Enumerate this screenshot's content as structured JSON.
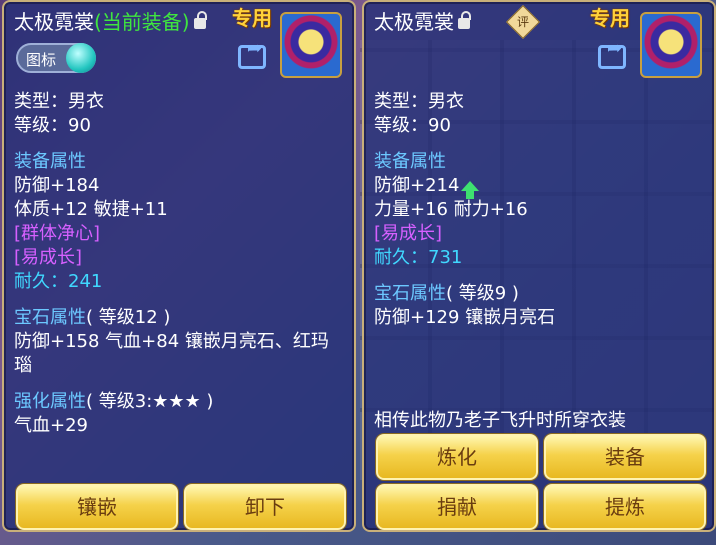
{
  "left": {
    "title": "太极霓裳",
    "equipped_tag": "(当前装备)",
    "exclusive": "专用",
    "toggle_label": "图标",
    "type_line": "类型：男衣",
    "level_line": "等级：90",
    "attr_header": "装备属性",
    "attrs": [
      "防御+184",
      "体质+12 敏捷+11"
    ],
    "specials": [
      "[群体净心]",
      "[易成长]"
    ],
    "durability": "耐久：241",
    "gem_header": "宝石属性",
    "gem_level": "( 等级12 )",
    "gem_text": "防御+158 气血+84 镶嵌月亮石、红玛瑙",
    "enhance_header": "强化属性",
    "enhance_level": "( 等级3:★★★ )",
    "enhance_text": "气血+29",
    "buttons": [
      "镶嵌",
      "卸下"
    ]
  },
  "right": {
    "title": "太极霓裳",
    "rate_badge": "评",
    "exclusive": "专用",
    "type_line": "类型：男衣",
    "level_line": "等级：90",
    "attr_header": "装备属性",
    "attrs": [
      "防御+214",
      "力量+16 耐力+16"
    ],
    "special": "[易成长]",
    "durability": "耐久：731",
    "gem_header": "宝石属性",
    "gem_level": "( 等级9 )",
    "gem_text": "防御+129 镶嵌月亮石",
    "lore": "相传此物乃老子飞升时所穿衣装",
    "buttons": [
      "炼化",
      "装备",
      "捐献",
      "提炼"
    ]
  },
  "colors": {
    "panel": "#263078",
    "section": "#6cc8ff",
    "special": "#d660ff",
    "durability": "#40d8ff",
    "equipped": "#3fe63f",
    "exclusive": "#ffd23a",
    "button": "#f5d24a"
  }
}
